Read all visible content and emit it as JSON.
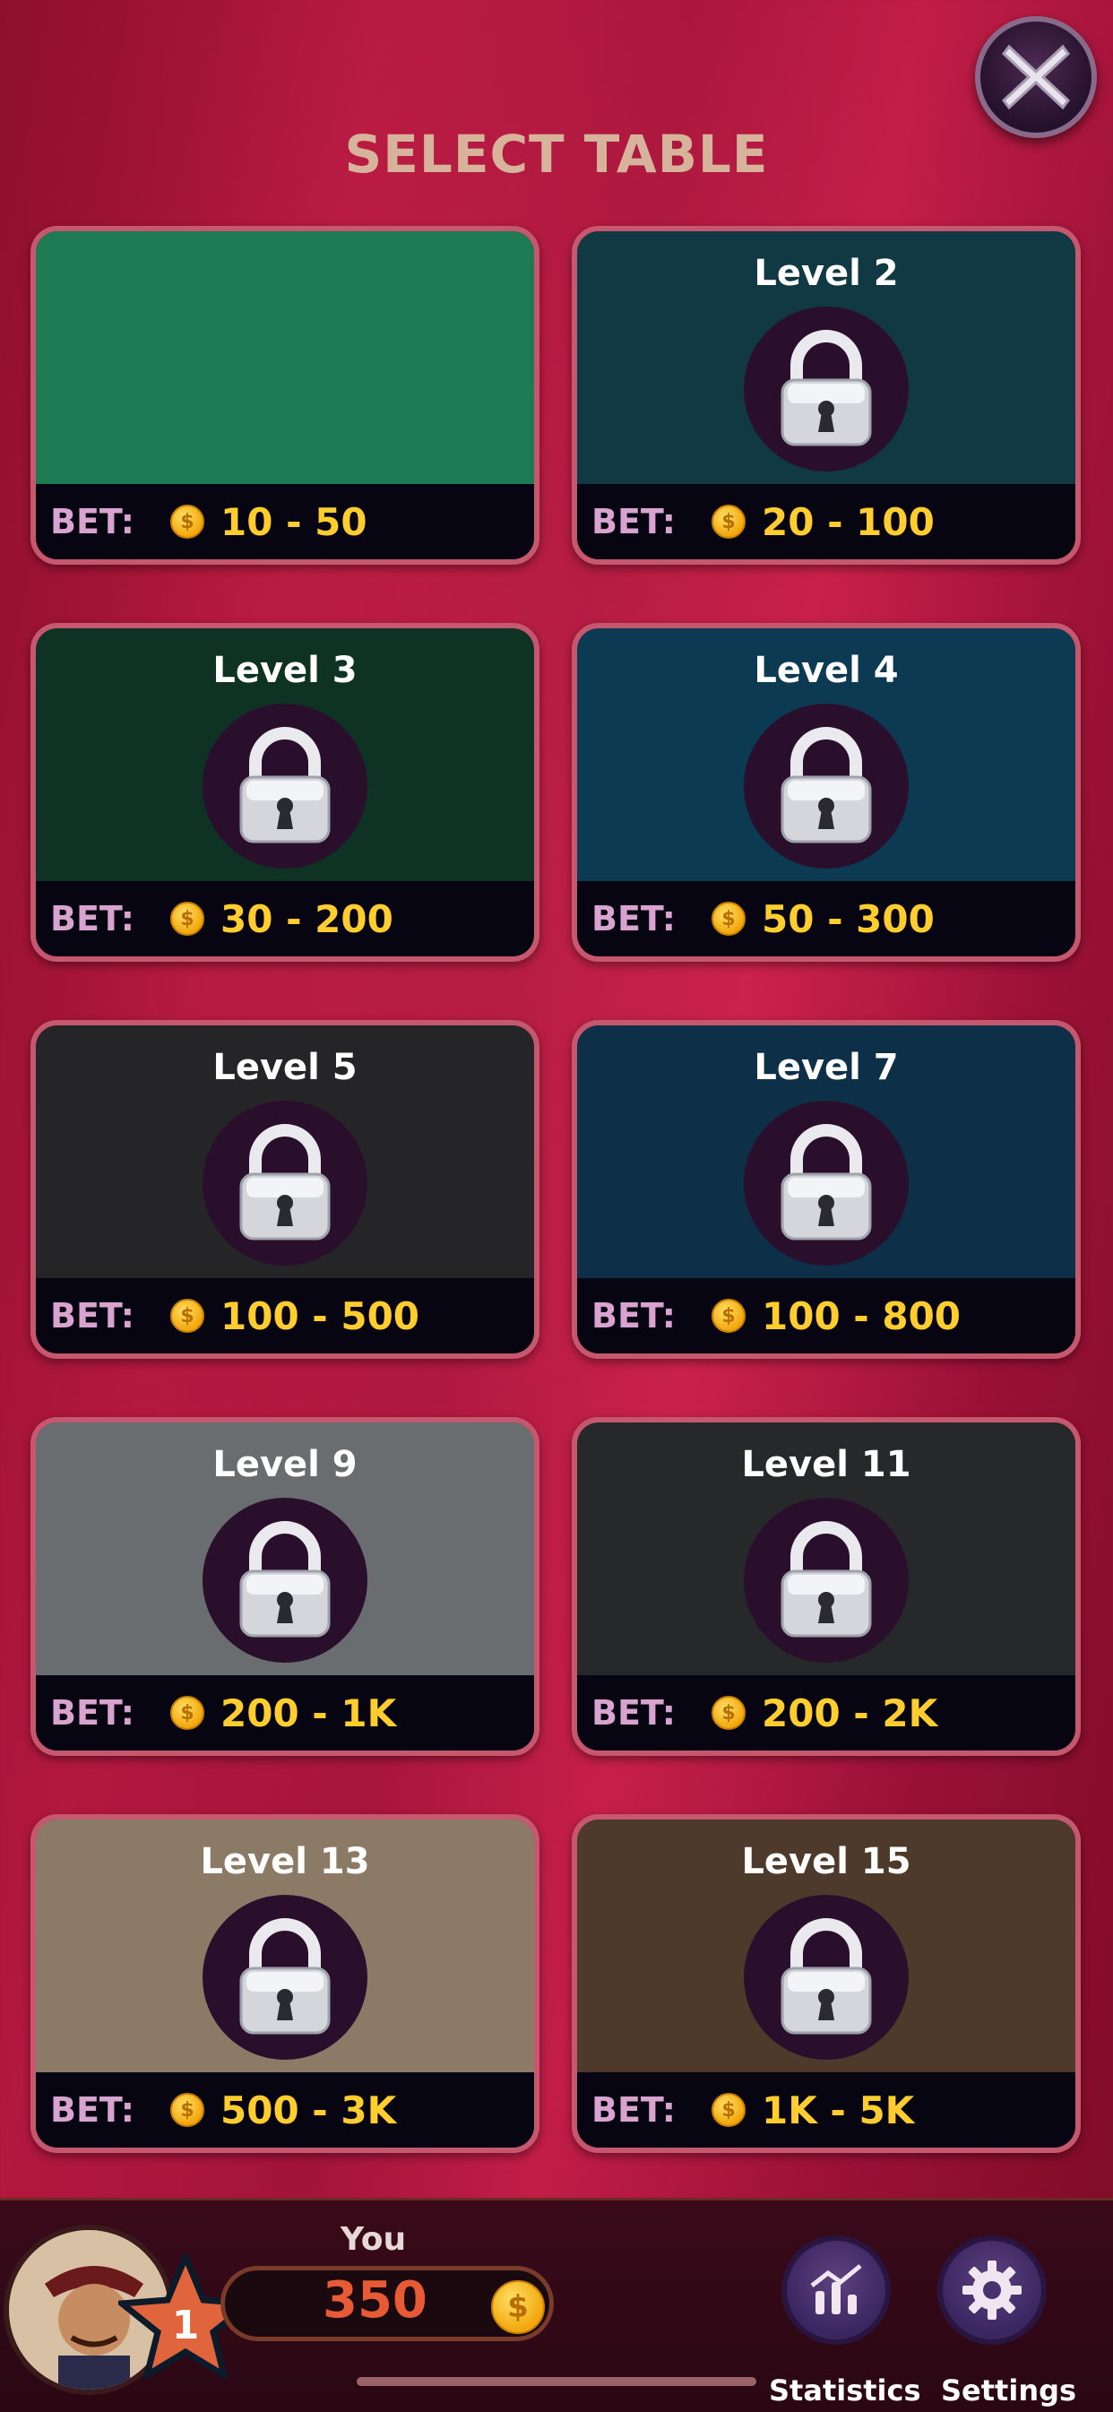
{
  "title": "SELECT TABLE",
  "close_button": {
    "icon": "close-x-icon",
    "label": "X"
  },
  "bet_label": "BET:",
  "tables": [
    {
      "level": "",
      "bet_range": "10 - 50",
      "felt_color": "#1e7a52",
      "locked": false
    },
    {
      "level": "Level 2",
      "bet_range": "20 - 100",
      "felt_color": "#103944",
      "locked": true
    },
    {
      "level": "Level 3",
      "bet_range": "30 - 200",
      "felt_color": "#0e3325",
      "locked": true
    },
    {
      "level": "Level 4",
      "bet_range": "50 - 300",
      "felt_color": "#0c3a52",
      "locked": true
    },
    {
      "level": "Level 5",
      "bet_range": "100 - 500",
      "felt_color": "#252527",
      "locked": true
    },
    {
      "level": "Level 7",
      "bet_range": "100 - 800",
      "felt_color": "#0d3048",
      "locked": true
    },
    {
      "level": "Level 9",
      "bet_range": "200 - 1K",
      "felt_color": "#6a6d70",
      "locked": true
    },
    {
      "level": "Level 11",
      "bet_range": "200 - 2K",
      "felt_color": "#26282a",
      "locked": true
    },
    {
      "level": "Level 13",
      "bet_range": "500 - 3K",
      "felt_color": "#8b7b66",
      "locked": true
    },
    {
      "level": "Level 15",
      "bet_range": "1K - 5K",
      "felt_color": "#4d3a2a",
      "locked": true
    }
  ],
  "player": {
    "name": "You",
    "coins": "350",
    "level": "1"
  },
  "buttons": {
    "statistics": "Statistics",
    "settings": "Settings"
  }
}
